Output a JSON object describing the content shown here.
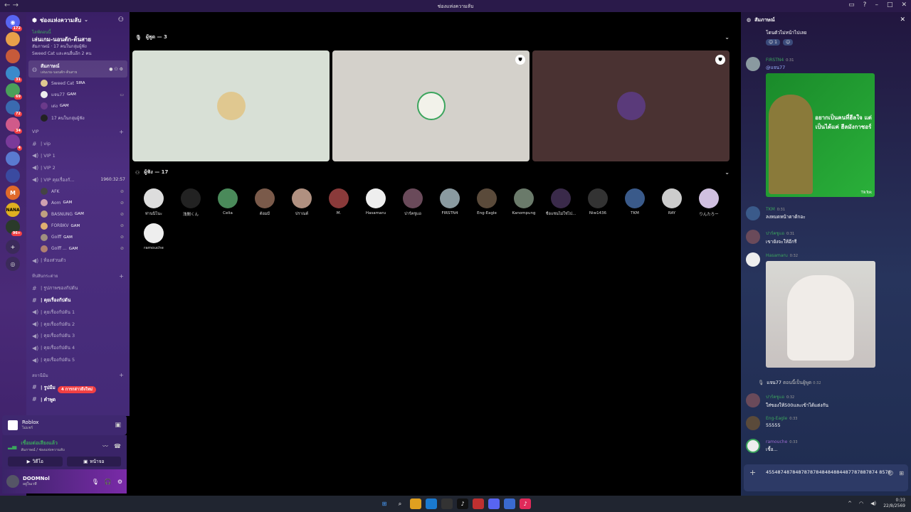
{
  "window": {
    "title": "ช่องแห่งความลับ",
    "back": "←",
    "forward": "→"
  },
  "rail_badges": [
    "172",
    "31",
    "69",
    "72",
    "34",
    "4",
    "96+"
  ],
  "server": {
    "name": "ช่องแห่งความลับ"
  },
  "event": {
    "live": "ไลฟ์ตอนนี้",
    "title": "เล่นเกม-นอนตัก-ต้นสาย",
    "line1": "สัมภาษณ์ · 17 คนในกลุ่มผู้ฟัง",
    "line2": "Sweed Cat และคนอื่นอีก 2 คน"
  },
  "active_channel": {
    "name": "สัมภาษณ์",
    "sub": "เล่นเกม-นอนตัก-ต้นสาย"
  },
  "stage_users": [
    {
      "name": "Sweed Cat",
      "tag": "SIRA"
    },
    {
      "name": "แจน77",
      "tag": "GAM"
    },
    {
      "name": "เด่ง",
      "tag": "GAM"
    },
    {
      "name": "17 คนในกลุ่มผู้ฟัง",
      "tag": ""
    }
  ],
  "vip_category": "VIP",
  "vip_channels": [
    "| vip",
    "| VIP 1",
    "| VIP 2",
    "| VIP คุยเรื่องกั...",
    "| ห้องส่วนตัว"
  ],
  "vip_timer": "1960:32:57",
  "vip_users": [
    {
      "name": "AFK",
      "tag": ""
    },
    {
      "name": "Aom",
      "tag": "GAM"
    },
    {
      "name": "BASNUNG",
      "tag": "GAM"
    },
    {
      "name": "FORBKV",
      "tag": "GAM"
    },
    {
      "name": "Golff",
      "tag": "GAM"
    },
    {
      "name": "Golff ...",
      "tag": "GAM"
    }
  ],
  "cat2": "ทีปสันกระต่าย",
  "cat2_channels": [
    "| รูปภาพของกัปตัน",
    "| คุยเรื่องกัปตัน",
    "| คุยเรื่องกัปตัน 1",
    "| คุยเรื่องกัปตัน 2",
    "| คุยเรื่องกัปตัน 3",
    "| คุยเรื่องกัปตัน 4",
    "| คุยเรื่องกัปตัน 5"
  ],
  "cat3": "สถานีมีม",
  "cat3_channels": [
    "| รูปมีม",
    "| คำพูด"
  ],
  "mention_pill": "4 การกล่าวถึงใหม่",
  "activity": {
    "name": "Roblox",
    "sub": "ไม่แชร์"
  },
  "voice": {
    "connected": "เชื่อมต่อเสียงแล้ว",
    "path": "สัมภาษณ์ / ช่องแห่งความลับ",
    "video": "วิดีโอ",
    "screen": "หน้าจอ"
  },
  "user": {
    "name": "DOOMNol",
    "status": "อยู่ในเวที"
  },
  "stage": {
    "speakers_label": "ผู้พูด — 3",
    "audience_label": "ผู้ฟัง — 17"
  },
  "speaker_tiles": [
    {
      "bg": "#d8e0d6",
      "avatar": "#e0c890",
      "shield": false
    },
    {
      "bg": "#d4d1cb",
      "avatar": "#f2f2ea",
      "shield": true
    },
    {
      "bg": "#4a3232",
      "avatar": "#5a3a7a",
      "shield": true
    }
  ],
  "audience": [
    {
      "name": "ท่านนิโนะ",
      "color": "#ddd"
    },
    {
      "name": "浅間くん",
      "color": "#222"
    },
    {
      "name": "Celia",
      "color": "#4a8a5a"
    },
    {
      "name": "ต้อมมี่",
      "color": "#7a5a4a"
    },
    {
      "name": "ปราณต์",
      "color": "#b09080"
    },
    {
      "name": "M.",
      "color": "#8a3a3a"
    },
    {
      "name": "Hasamaru",
      "color": "#eee"
    },
    {
      "name": "ปาร์คชูแอ",
      "color": "#6a4a5a"
    },
    {
      "name": "FIRSTN4",
      "color": "#8a9aa0"
    },
    {
      "name": "Eng-Eagle",
      "color": "#5a4a3a"
    },
    {
      "name": "Kanompung",
      "color": "#6a7a6a"
    },
    {
      "name": "ชื่อแชนไม่ใช่ไป...",
      "color": "#3a2a4a"
    },
    {
      "name": "Niw1436",
      "color": "#333"
    },
    {
      "name": "TKM",
      "color": "#3a5a8a"
    },
    {
      "name": "RAY",
      "color": "#ccc"
    },
    {
      "name": "りんたろー",
      "color": "#d0c0e0"
    },
    {
      "name": "ramouche",
      "color": "#eee"
    }
  ],
  "chat": {
    "title": "สัมภาษณ์",
    "top_text": "โดนตัวไม่หน้าไปเลย",
    "reaction_count": "1",
    "messages": [
      {
        "user": "FIRSTN4",
        "time": "0:31",
        "text": "@แจน77"
      },
      {
        "user": "TKM",
        "time": "0:31",
        "text": "ลงหมดหน้าตาด้กอะ"
      },
      {
        "user": "ปาร์คชูแอ",
        "time": "0:31",
        "text": "เขายังจะให้อีกรี"
      },
      {
        "user": "Hasamaru",
        "time": "0:32",
        "text": ""
      },
      {
        "user": "ปาร์คชูแอ",
        "time": "0:32",
        "text": "ใส่ของให้500และเข้าได้แต่งกัน"
      },
      {
        "user": "Eng-Eagle",
        "time": "0:33",
        "text": "55555"
      },
      {
        "user": "ramouche",
        "time": "0:33",
        "text": "เชื้อ..."
      }
    ],
    "system": {
      "user": "แจน77",
      "text": "ตอนนี้เป็นผู้พูด",
      "time": "0:32"
    },
    "img1_text": "อยากเป็นคนที่ฮีลใจ แต่เป็นได้แค่ ฮีลมังกาซอร์",
    "img1_credit": "TikTok",
    "input": "45548748784878787848484884487787887874 8578"
  },
  "taskbar": {
    "time": "0:33",
    "date": "22/8/2569"
  }
}
